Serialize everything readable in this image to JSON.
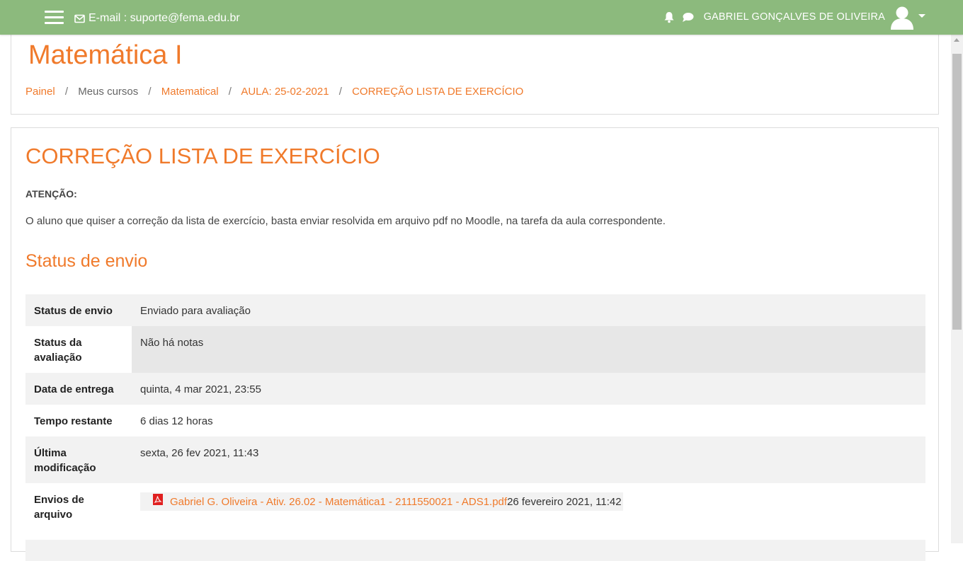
{
  "navbar": {
    "email_label": "E-mail : suporte@fema.edu.br",
    "user_name": "GABRIEL GONÇALVES DE OLIVEIRA",
    "icons": [
      "menu-icon",
      "envelope-icon",
      "bell-icon",
      "chat-icon",
      "user-avatar-icon",
      "caret-down-icon"
    ],
    "background_color": "#8cba7d"
  },
  "header": {
    "course_title": "Matemática I",
    "breadcrumb": [
      {
        "label": "Painel",
        "link": true
      },
      {
        "label": "Meus cursos",
        "link": false
      },
      {
        "label": "Matematical",
        "link": true
      },
      {
        "label": "AULA: 25-02-2021",
        "link": true
      },
      {
        "label": "CORREÇÃO LISTA DE EXERCÍCIO",
        "link": true
      }
    ],
    "separator": "/"
  },
  "main": {
    "activity_title": "CORREÇÃO LISTA DE EXERCÍCIO",
    "attention_label": "ATENÇÃO:",
    "description": "O aluno que quiser a correção da lista de exercício, basta enviar resolvida em arquivo pdf no Moodle, na tarefa da aula correspondente.",
    "section_title": "Status de envio",
    "status_rows": [
      {
        "label": "Status de envio",
        "value": "Enviado para avaliação"
      },
      {
        "label": "Status da avaliação",
        "value": "Não há notas"
      },
      {
        "label": "Data de entrega",
        "value": "quinta, 4 mar 2021, 23:55"
      },
      {
        "label": "Tempo restante",
        "value": "6 dias 12 horas"
      },
      {
        "label": "Última modificação",
        "value": "sexta, 26 fev 2021, 11:43"
      },
      {
        "label": "Envios de arquivo",
        "file_name": "Gabriel G. Oliveira - Ativ. 26.02 - Matemática1 - 2111550021 - ADS1.pdf",
        "file_date": "26 fevereiro 2021, 11:42"
      }
    ]
  },
  "colors": {
    "accent": "#f07a2b",
    "table_stripe": "#f2f2f2"
  }
}
